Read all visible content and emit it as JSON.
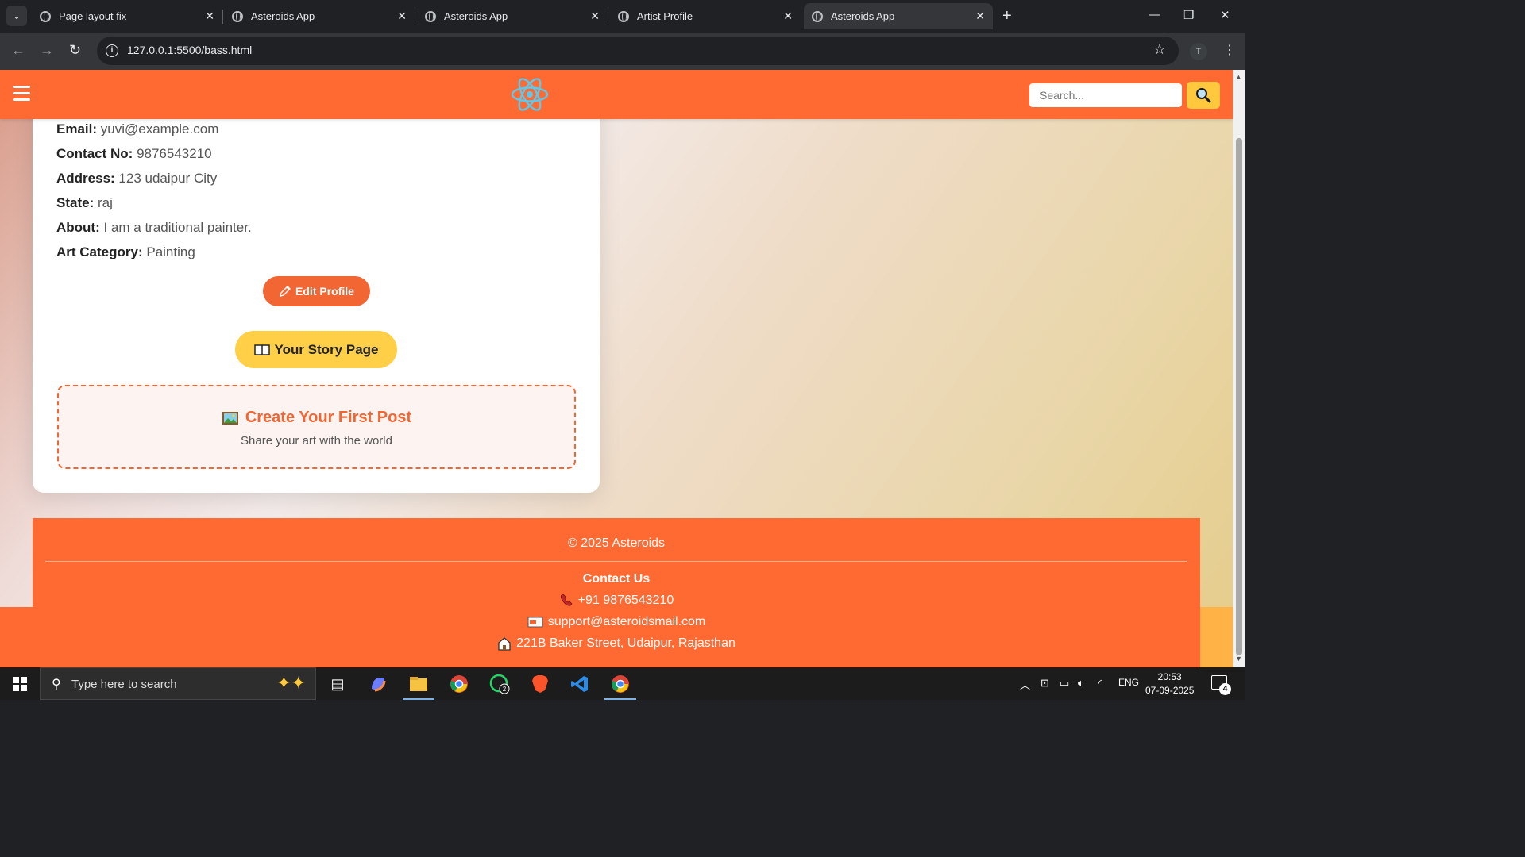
{
  "browser": {
    "tabs": [
      {
        "title": "Page layout fix",
        "active": false
      },
      {
        "title": "Asteroids App",
        "active": false
      },
      {
        "title": "Asteroids App",
        "active": false
      },
      {
        "title": "Artist Profile",
        "active": false
      },
      {
        "title": "Asteroids App",
        "active": true
      }
    ],
    "url": "127.0.0.1:5500/bass.html",
    "profile_initial": "T"
  },
  "header": {
    "search_placeholder": "Search..."
  },
  "profile": {
    "fields": [
      {
        "label": "Email:",
        "value": "yuvi@example.com"
      },
      {
        "label": "Contact No:",
        "value": "9876543210"
      },
      {
        "label": "Address:",
        "value": "123 udaipur City"
      },
      {
        "label": "State:",
        "value": "raj"
      },
      {
        "label": "About:",
        "value": "I am a traditional painter."
      },
      {
        "label": "Art Category:",
        "value": "Painting"
      }
    ],
    "edit_button": "Edit Profile",
    "story_button": "Your Story Page",
    "first_post_title": "Create Your First Post",
    "first_post_subtitle": "Share your art with the world"
  },
  "footer": {
    "copyright": "© 2025 Asteroids",
    "contact_title": "Contact Us",
    "phone": "+91 9876543210",
    "email": "support@asteroidsmail.com",
    "address": "221B Baker Street, Udaipur, Rajasthan"
  },
  "taskbar": {
    "search_placeholder": "Type here to search",
    "language": "ENG",
    "time": "20:53",
    "date": "07-09-2025",
    "notification_count": "4",
    "whatsapp_badge": "2"
  },
  "colors": {
    "header_orange": "#ff6a33",
    "accent_orange": "#f26634",
    "accent_yellow": "#ffcf47"
  }
}
